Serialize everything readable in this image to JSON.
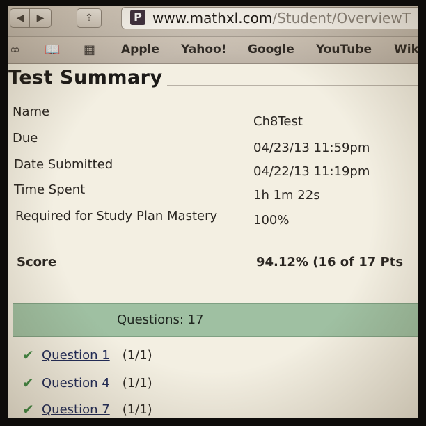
{
  "browser": {
    "url_domain": "www.mathxl.com",
    "url_path": "/Student/OverviewT",
    "site_icon_letter": "P",
    "bookmarks": [
      "Apple",
      "Yahoo!",
      "Google",
      "YouTube",
      "Wik"
    ]
  },
  "page": {
    "title": "Test Summary",
    "details": [
      {
        "label": "Name",
        "value": "Ch8Test"
      },
      {
        "label": "Due",
        "value": "04/23/13 11:59pm"
      },
      {
        "label": "Date Submitted",
        "value": "04/22/13 11:19pm"
      },
      {
        "label": "Time Spent",
        "value": "1h 1m 22s"
      },
      {
        "label": "Required for Study Plan Mastery",
        "value": "100%"
      }
    ],
    "score_label": "Score",
    "score_value": "94.12% (16 of 17 Pts",
    "questions_header": "Questions: 17",
    "questions": [
      {
        "label": "Question 1",
        "score": "(1/1)"
      },
      {
        "label": "Question 4",
        "score": "(1/1)"
      },
      {
        "label": "Question 7",
        "score": "(1/1)"
      }
    ]
  },
  "colors": {
    "accent_green": "#9fc0a2",
    "check_green": "#3f8a45",
    "link_blue": "#1f2a58"
  }
}
